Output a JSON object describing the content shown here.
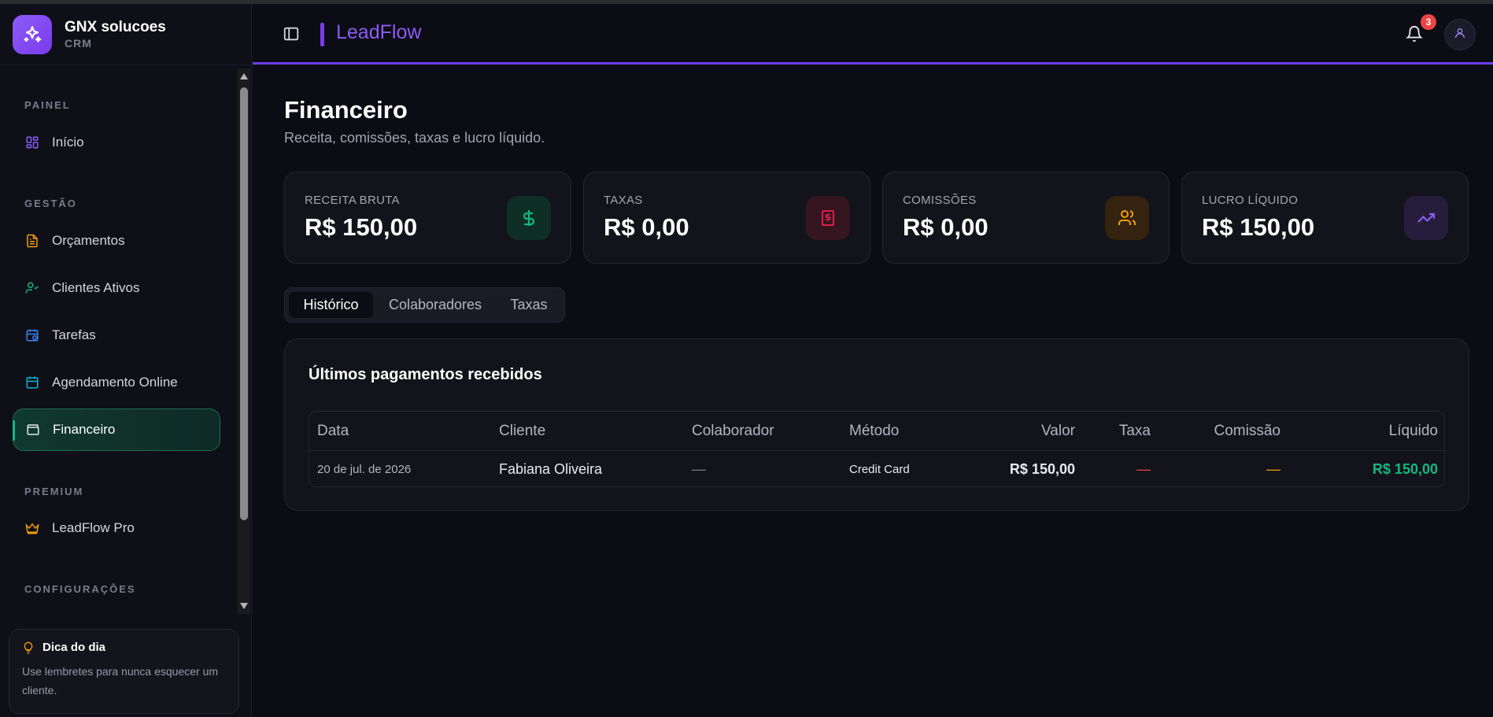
{
  "colors": {
    "accent": "#7c3aed",
    "success": "#10b981",
    "danger": "#ef4444",
    "warning": "#f59e0b"
  },
  "brand": {
    "name": "GNX solucoes",
    "subtitle": "CRM",
    "logo_icon": "sparkles-icon"
  },
  "sidebar": {
    "sections": [
      {
        "label": "PAINEL",
        "items": [
          {
            "label": "Início",
            "icon": "grid-icon"
          }
        ]
      },
      {
        "label": "GESTÃO",
        "items": [
          {
            "label": "Orçamentos",
            "icon": "file-text-icon"
          },
          {
            "label": "Clientes Ativos",
            "icon": "user-check-icon"
          },
          {
            "label": "Tarefas",
            "icon": "calendar-clock-icon"
          },
          {
            "label": "Agendamento Online",
            "icon": "calendar-icon"
          },
          {
            "label": "Financeiro",
            "icon": "wallet-icon",
            "active": true
          }
        ]
      },
      {
        "label": "PREMIUM",
        "items": [
          {
            "label": "LeadFlow Pro",
            "icon": "crown-icon"
          }
        ]
      },
      {
        "label": "CONFIGURAÇÕES",
        "items": []
      }
    ],
    "tip": {
      "title": "Dica do dia",
      "body": "Use lembretes para nunca esquecer um cliente.",
      "icon": "lightbulb-icon"
    }
  },
  "header": {
    "title": "LeadFlow",
    "notification_count": "3",
    "toggle_icon": "sidebar-toggle-icon",
    "bell_icon": "bell-icon",
    "avatar_icon": "user-icon"
  },
  "page": {
    "title": "Financeiro",
    "subtitle": "Receita, comissões, taxas e lucro líquido."
  },
  "stats": [
    {
      "label": "RECEITA BRUTA",
      "value": "R$ 150,00",
      "icon": "dollar-icon",
      "color": "#10b981"
    },
    {
      "label": "TAXAS",
      "value": "R$ 0,00",
      "icon": "receipt-icon",
      "color": "#e11d48"
    },
    {
      "label": "COMISSÕES",
      "value": "R$ 0,00",
      "icon": "users-icon",
      "color": "#f59e0b"
    },
    {
      "label": "LUCRO LÍQUIDO",
      "value": "R$ 150,00",
      "icon": "trending-up-icon",
      "color": "#8b5cf6"
    }
  ],
  "tabs": [
    {
      "label": "Histórico",
      "active": true
    },
    {
      "label": "Colaboradores"
    },
    {
      "label": "Taxas"
    }
  ],
  "payments": {
    "title": "Últimos pagamentos recebidos",
    "columns": [
      "Data",
      "Cliente",
      "Colaborador",
      "Método",
      "Valor",
      "Taxa",
      "Comissão",
      "Líquido"
    ],
    "rows": [
      {
        "data": "20 de jul. de 2026",
        "cliente": "Fabiana Oliveira",
        "colaborador": "—",
        "metodo": "Credit Card",
        "valor": "R$ 150,00",
        "taxa": "—",
        "comissao": "—",
        "liquido": "R$ 150,00"
      }
    ]
  }
}
